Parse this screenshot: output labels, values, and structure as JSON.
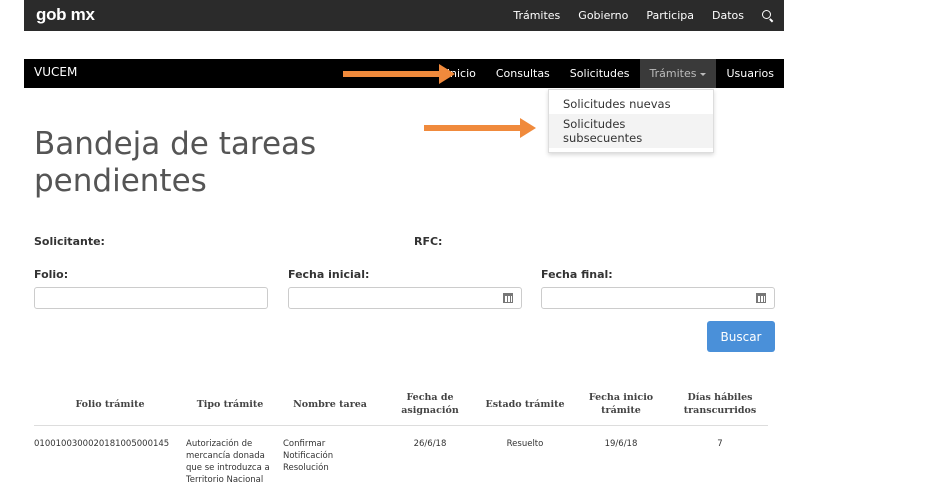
{
  "gov_header": {
    "logo": "gob mx",
    "nav": [
      "Trámites",
      "Gobierno",
      "Participa",
      "Datos"
    ],
    "search_icon": "search-icon"
  },
  "app_nav": {
    "brand": "VUCEM",
    "items": [
      "Inicio",
      "Consultas",
      "Solicitudes",
      "Trámites",
      "Usuarios"
    ],
    "active": "Trámites"
  },
  "dropdown": {
    "options": [
      "Solicitudes nuevas",
      "Solicitudes subsecuentes"
    ]
  },
  "page": {
    "title": "Bandeja de tareas pendientes"
  },
  "form": {
    "solicitante_label": "Solicitante:",
    "rfc_label": "RFC:",
    "folio_label": "Folio:",
    "fecha_inicial_label": "Fecha inicial:",
    "fecha_final_label": "Fecha final:",
    "buscar_label": "Buscar"
  },
  "table": {
    "headers": [
      "Folio trámite",
      "Tipo trámite",
      "Nombre tarea",
      "Fecha de asignación",
      "Estado trámite",
      "Fecha inicio trámite",
      "Días hábiles transcurridos"
    ],
    "rows": [
      [
        "0100100300020181005000145",
        "Autorización de mercancía donada que se introduzca a Territorio Nacional",
        "Confirmar Notificación Resolución",
        "26/6/18",
        "Resuelto",
        "19/6/18",
        "7"
      ]
    ]
  },
  "colors": {
    "gov_bar": "#2b2b2b",
    "app_bar": "#000000",
    "arrow": "#f08a3c",
    "button": "#4a90d9"
  }
}
